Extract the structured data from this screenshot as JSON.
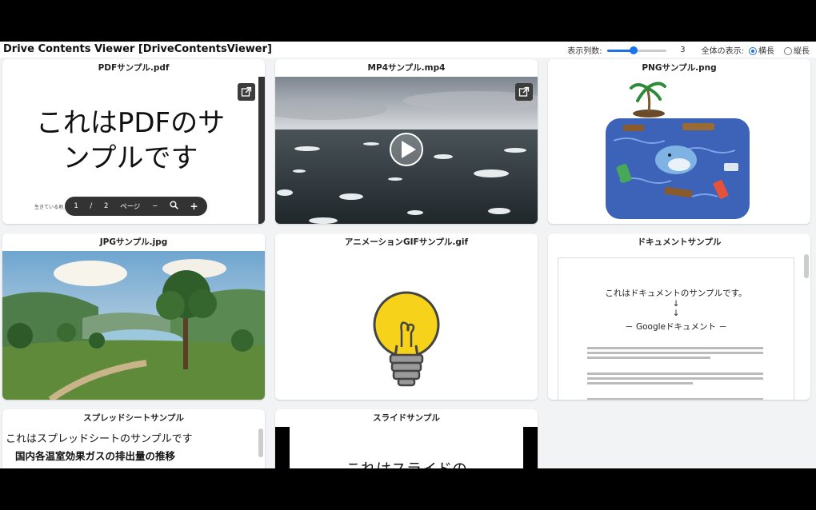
{
  "header": {
    "title": "Drive Contents Viewer [DriveContentsViewer]",
    "columns_label": "表示列数:",
    "columns_value": "3",
    "columns_fraction": 0.4,
    "layout_label": "全体の表示:",
    "layout_horizontal": "横長",
    "layout_vertical": "縦長",
    "layout_selected": "横長"
  },
  "cards": {
    "pdf": {
      "title": "PDFサンプル.pdf",
      "text": "これはPDFのサンプルです",
      "text_line1": "これはPDFのサ",
      "text_line2": "ンプルです",
      "body_snippet": "生きている地…",
      "toolbar_page": "1",
      "toolbar_sep": "/",
      "toolbar_total": "2",
      "toolbar_mode": "ページ"
    },
    "mp4": {
      "title": "MP4サンプル.mp4"
    },
    "png": {
      "title": "PNGサンプル.png"
    },
    "jpg": {
      "title": "JPGサンプル.jpg"
    },
    "gif": {
      "title": "アニメーションGIFサンプル.gif"
    },
    "doc": {
      "title": "ドキュメントサンプル",
      "line1": "これはドキュメントのサンプルです。",
      "arrow": "↓",
      "line2": "－ Googleドキュメント －"
    },
    "sheet": {
      "title": "スプレッドシートサンプル",
      "line1": "これはスプレッドシートのサンプルです",
      "line2": "国内各温室効果ガスの排出量の推移"
    },
    "slide": {
      "title": "スライドサンプル",
      "text": "これはスライドの"
    }
  },
  "colors": {
    "accent": "#1a73e8",
    "card_bg": "#ffffff",
    "app_bg": "#f1f3f4"
  }
}
